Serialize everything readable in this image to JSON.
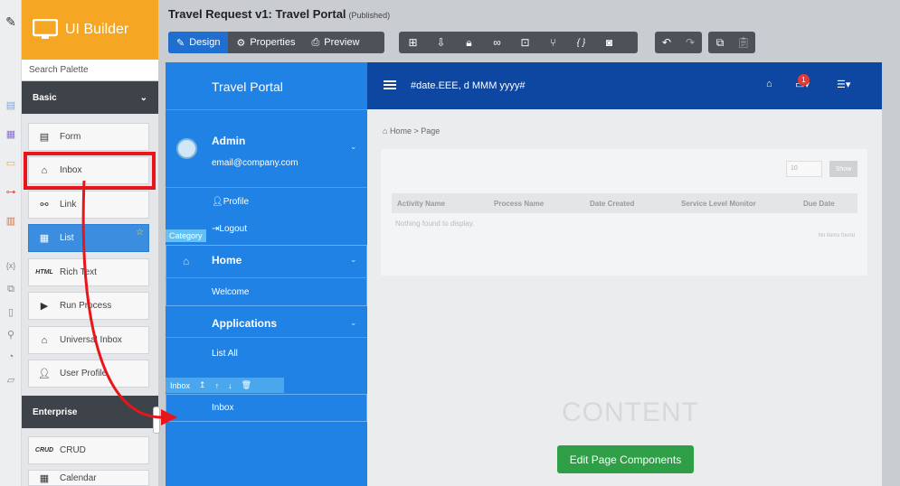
{
  "brand": {
    "name": "UI Builder"
  },
  "palette": {
    "search_placeholder": "Search Palette",
    "sections": {
      "basic": "Basic",
      "enterprise": "Enterprise"
    },
    "items": [
      {
        "label": "Form",
        "icon": "form-icon"
      },
      {
        "label": "Inbox",
        "icon": "inbox-icon"
      },
      {
        "label": "Link",
        "icon": "link-icon"
      },
      {
        "label": "List",
        "icon": "list-icon",
        "active": true
      },
      {
        "label": "Rich Text",
        "icon": "html-icon",
        "icon_text": "HTML"
      },
      {
        "label": "Run Process",
        "icon": "play-icon"
      },
      {
        "label": "Universal Inbox",
        "icon": "inbox-icon"
      },
      {
        "label": "User Profile",
        "icon": "user-edit-icon"
      },
      {
        "label": "CRUD",
        "icon": "crud-icon",
        "icon_text": "CRUD"
      },
      {
        "label": "Calendar",
        "icon": "calendar-icon"
      }
    ]
  },
  "header": {
    "title": "Travel Request v1: Travel Portal",
    "status": "(Published)",
    "tabs": {
      "design": "Design",
      "properties": "Properties",
      "preview": "Preview"
    }
  },
  "sidenav": {
    "title": "Travel Portal",
    "user_name": "Admin",
    "user_email": "email@company.com",
    "profile": "Profile",
    "logout": "Logout",
    "category_tag": "Category",
    "home": "Home",
    "welcome": "Welcome",
    "applications": "Applications",
    "list_all": "List All",
    "inbox_tag": "Inbox",
    "inbox": "Inbox"
  },
  "topbar": {
    "date_format": "#date.EEE, d MMM yyyy#",
    "badge": "1"
  },
  "content": {
    "breadcrumb": "Home > Page",
    "page_size": "10",
    "show_button": "Show",
    "columns": [
      "Activity Name",
      "Process Name",
      "Date Created",
      "Service Level Monitor",
      "Due Date"
    ],
    "empty_text": "Nothing found to display.",
    "no_items": "No items found",
    "placeholder": "CONTENT",
    "edit_button": "Edit Page Components"
  },
  "colors": {
    "brand": "#f5a623",
    "sidenav": "#1f82e4",
    "topbar": "#0d47a1",
    "highlight": "#e8151b",
    "edit": "#2e9e47"
  }
}
